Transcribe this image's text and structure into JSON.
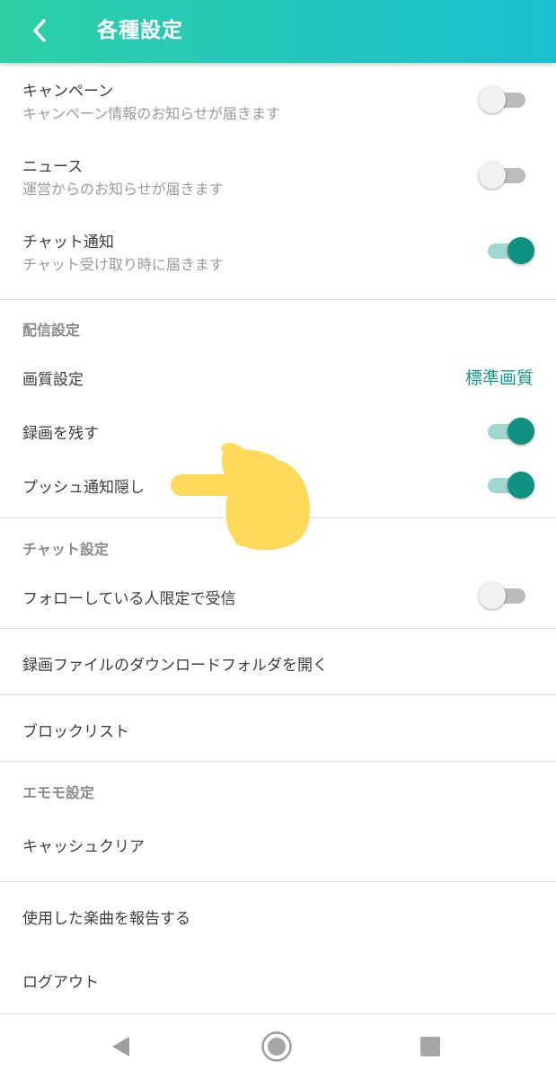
{
  "header": {
    "title": "各種設定",
    "back_icon": "chevron-left-icon"
  },
  "notifications": [
    {
      "title": "キャンペーン",
      "subtitle": "キャンペーン情報のお知らせが届きます",
      "enabled": false
    },
    {
      "title": "ニュース",
      "subtitle": "運営からのお知らせが届きます",
      "enabled": false
    },
    {
      "title": "チャット通知",
      "subtitle": "チャット受け取り時に届きます",
      "enabled": true
    }
  ],
  "broadcast": {
    "heading": "配信設定",
    "quality": {
      "title": "画質設定",
      "value": "標準画質"
    },
    "keep_recording": {
      "title": "録画を残す",
      "enabled": true
    },
    "hide_push": {
      "title": "プッシュ通知隠し",
      "enabled": true
    }
  },
  "chat_settings": {
    "heading": "チャット設定",
    "followers_only": {
      "title": "フォローしている人限定で受信",
      "enabled": false
    }
  },
  "menu": {
    "open_folder": "録画ファイルのダウンロードフォルダを開く",
    "block_list": "ブロックリスト"
  },
  "emomo": {
    "heading": "エモモ設定",
    "cache_clear": "キャッシュクリア"
  },
  "footer_menu": {
    "report_music": "使用した楽曲を報告する",
    "logout": "ログアウト"
  },
  "navigation": {
    "back": "triangle-back-icon",
    "home": "circle-home-icon",
    "recents": "square-recents-icon"
  },
  "colors": {
    "accent": "#14968a",
    "header_start": "#2ecfa6",
    "header_end": "#1bbfcf",
    "hand": "#ffd95a"
  }
}
